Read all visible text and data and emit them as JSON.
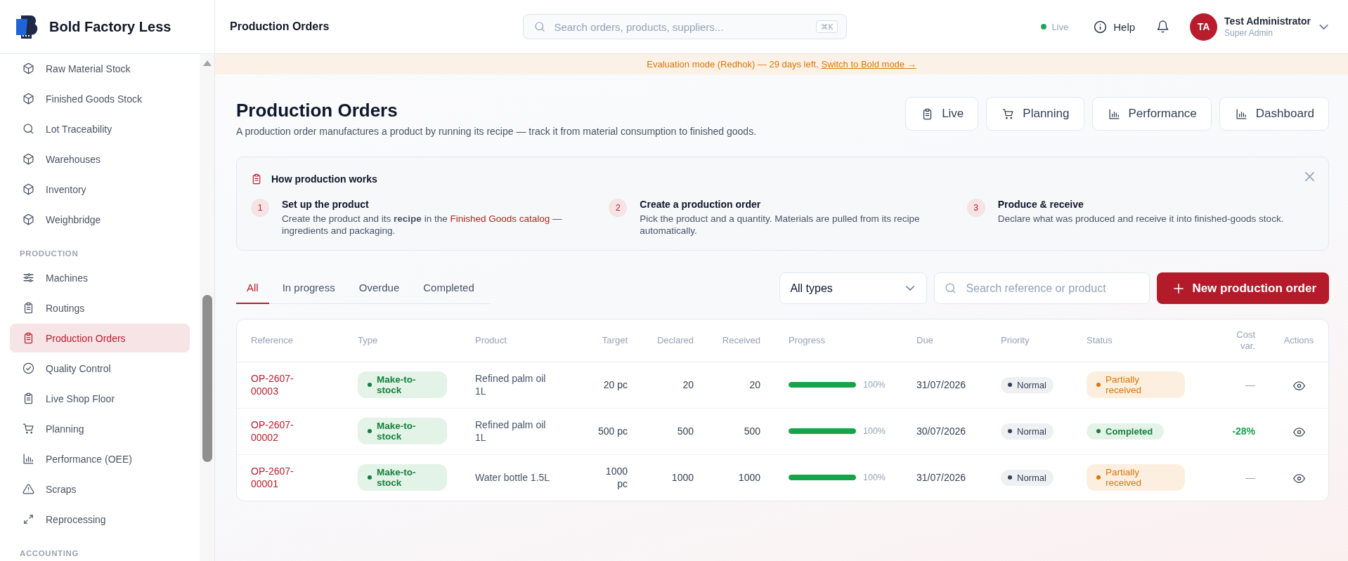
{
  "sidebar": {
    "brand": "Bold Factory Less",
    "groups": [
      {
        "items": [
          {
            "label": "Raw Material Stock",
            "selected": false
          },
          {
            "label": "Finished Goods Stock",
            "selected": false
          },
          {
            "label": "Lot Traceability",
            "selected": false
          },
          {
            "label": "Warehouses",
            "selected": false
          },
          {
            "label": "Inventory",
            "selected": false
          },
          {
            "label": "Weighbridge",
            "selected": false
          }
        ]
      },
      {
        "label": "PRODUCTION",
        "items": [
          {
            "label": "Machines",
            "selected": false
          },
          {
            "label": "Routings",
            "selected": false
          },
          {
            "label": "Production Orders",
            "selected": true
          },
          {
            "label": "Quality Control",
            "selected": false
          },
          {
            "label": "Live Shop Floor",
            "selected": false
          },
          {
            "label": "Planning",
            "selected": false
          },
          {
            "label": "Performance (OEE)",
            "selected": false
          },
          {
            "label": "Scraps",
            "selected": false
          },
          {
            "label": "Reprocessing",
            "selected": false
          }
        ]
      },
      {
        "label": "ACCOUNTING"
      }
    ]
  },
  "topbar": {
    "title": "Production Orders",
    "search": {
      "placeholder": "Search orders, products, suppliers...",
      "shortcut": "⌘K"
    },
    "status": {
      "label": "Live",
      "online": true
    },
    "help": "Help",
    "user": {
      "initials": "TA",
      "name": "Test Administrator",
      "role": "Super Admin"
    }
  },
  "banner": {
    "text": "Evaluation mode (Redhok) — 29 days left.",
    "link": "Switch to Bold mode →"
  },
  "page": {
    "title": "Production Orders",
    "subtitle": "A production order manufactures a product by running its recipe — track it from material consumption to finished goods.",
    "actions": [
      "Live",
      "Planning",
      "Performance",
      "Dashboard"
    ]
  },
  "guide": {
    "title": "How production works",
    "steps": [
      {
        "number": "1",
        "title": "Set up the product",
        "description": [
          {
            "kind": "text",
            "text": "Create the product and its **recipe** in the "
          },
          {
            "kind": "link",
            "text": "Finished Goods catalog"
          },
          {
            "kind": "text",
            "text": " — ingredients and packaging."
          }
        ]
      },
      {
        "number": "2",
        "title": "Create a production order",
        "description": [
          {
            "kind": "text",
            "text": "Pick the product and a quantity. Materials are pulled from its recipe automatically."
          }
        ]
      },
      {
        "number": "3",
        "title": "Produce & receive",
        "description": [
          {
            "kind": "text",
            "text": "Declare what was produced and receive it into finished-goods stock."
          }
        ]
      }
    ]
  },
  "tabs": [
    {
      "label": "All",
      "selected": true
    },
    {
      "label": "In progress",
      "selected": false
    },
    {
      "label": "Overdue",
      "selected": false
    },
    {
      "label": "Completed",
      "selected": false
    }
  ],
  "filters": {
    "type": "All types",
    "search": {
      "placeholder": "Search reference or product"
    },
    "new_button": "New production order"
  },
  "table": {
    "columns": [
      "Reference",
      "Type",
      "Product",
      "Target",
      "Declared",
      "Received",
      "Progress",
      "Due",
      "Priority",
      "Status",
      "Cost var.",
      "Actions"
    ],
    "rows": [
      {
        "reference": "OP-2607-00003",
        "type": "Make-to-stock",
        "product": "Refined palm oil 1L",
        "target": "20 pc",
        "declared": "20",
        "received": "20",
        "progress": {
          "level": 1,
          "label": "100%"
        },
        "due": "31/07/2026",
        "priority": "Normal",
        "status": {
          "text": "Partially received",
          "kind": "partial"
        },
        "cost_var": {
          "text": "—",
          "kind": "none"
        }
      },
      {
        "reference": "OP-2607-00002",
        "type": "Make-to-stock",
        "product": "Refined palm oil 1L",
        "target": "500 pc",
        "declared": "500",
        "received": "500",
        "progress": {
          "level": 1,
          "label": "100%"
        },
        "due": "30/07/2026",
        "priority": "Normal",
        "status": {
          "text": "Completed",
          "kind": "completed"
        },
        "cost_var": {
          "text": "-28%",
          "kind": "saving"
        }
      },
      {
        "reference": "OP-2607-00001",
        "type": "Make-to-stock",
        "product": "Water bottle 1.5L",
        "target": "1000 pc",
        "declared": "1000",
        "received": "1000",
        "progress": {
          "level": 1,
          "label": "100%"
        },
        "due": "31/07/2026",
        "priority": "Normal",
        "status": {
          "text": "Partially received",
          "kind": "partial"
        },
        "cost_var": {
          "text": "—",
          "kind": "none"
        }
      }
    ]
  }
}
